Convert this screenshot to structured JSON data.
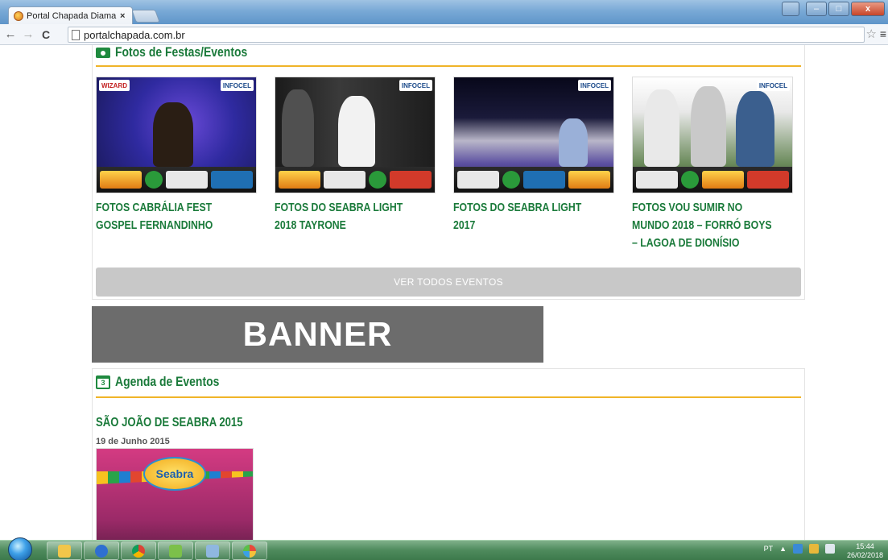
{
  "browser": {
    "tab_title": "Portal Chapada Diamanti",
    "tab_close": "×",
    "url": "portalchapada.com.br",
    "back_icon": "←",
    "forward_icon": "→",
    "reload_icon": "C",
    "star_icon": "☆",
    "menu_icon": "≡",
    "window_controls": {
      "minimize": "–",
      "maximize": "□",
      "close": "x"
    }
  },
  "festas": {
    "section_title": "Fotos de Festas/Eventos",
    "events": [
      {
        "title": "FOTOS CABRÁLIA FEST GOSPEL FERNANDINHO",
        "tag_left": "WIZARD",
        "tag_right": "INFOCEL"
      },
      {
        "title": "FOTOS DO SEABRA LIGHT 2018 TAYRONE",
        "tag_left": "",
        "tag_right": "INFOCEL"
      },
      {
        "title": "FOTOS DO SEABRA LIGHT 2017",
        "tag_left": "",
        "tag_right": "INFOCEL"
      },
      {
        "title": "FOTOS VOU SUMIR NO MUNDO 2018 – FORRÓ BOYS – LAGOA DE DIONÍSIO",
        "tag_left": "",
        "tag_right": "INFOCEL"
      }
    ],
    "view_all_label": "VER TODOS EVENTOS"
  },
  "banner": {
    "text": "BANNER"
  },
  "agenda": {
    "section_title": "Agenda de Eventos",
    "calendar_day": "3",
    "event_title": "SÃO JOÃO DE SEABRA 2015",
    "event_date": "19 de Junho 2015",
    "poster_text": "Seabra"
  },
  "taskbar": {
    "language": "PT",
    "tray_arrow": "▲",
    "clock_time": "15:44",
    "clock_date": "26/02/2018"
  }
}
